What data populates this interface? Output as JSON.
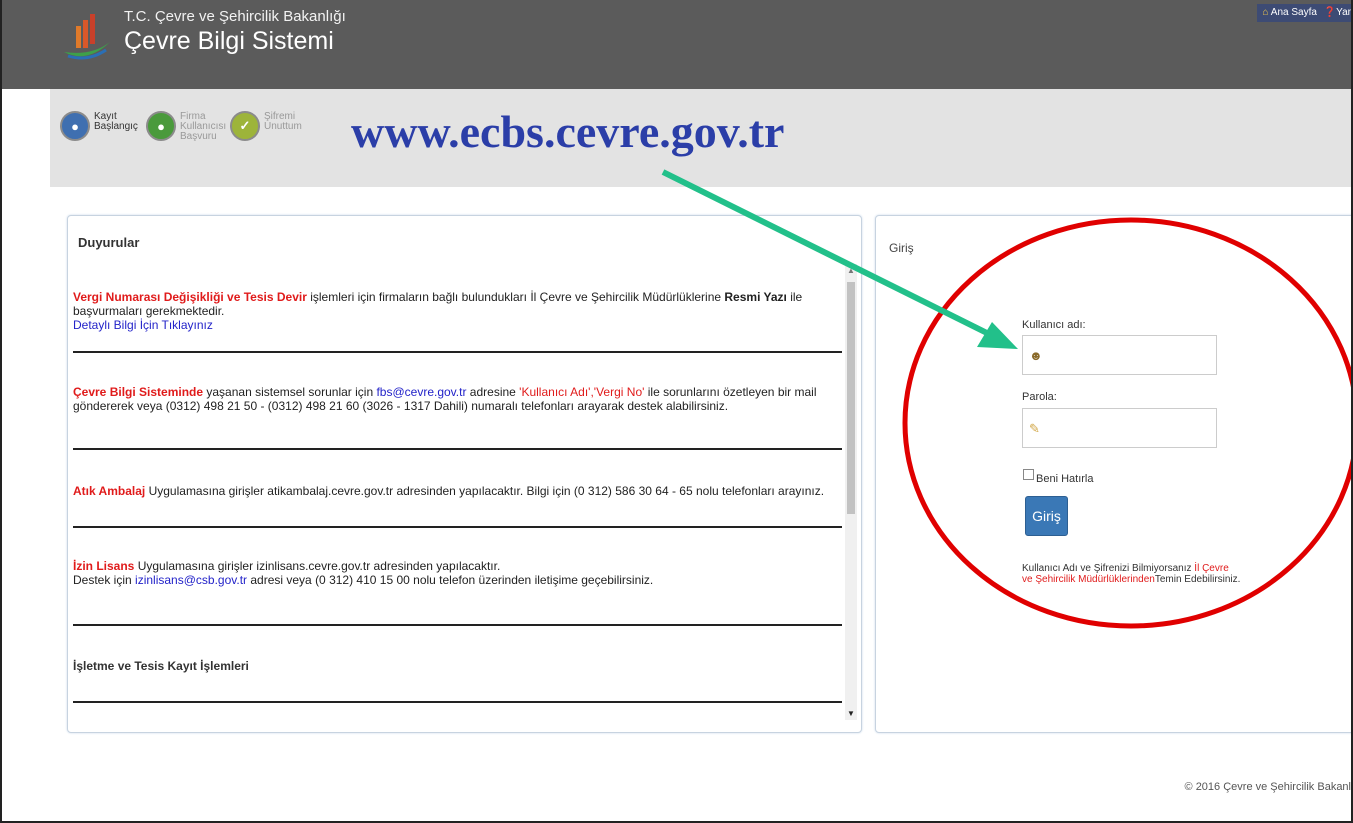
{
  "header": {
    "ministry": "T.C. Çevre ve Şehircilik Bakanlığı",
    "system_name": "Çevre Bilgi Sistemi",
    "home_link": "Ana Sayfa",
    "help_link": "Yar"
  },
  "nav": {
    "items": [
      {
        "label": "Kayıt Başlangıç",
        "icon": "user-icon"
      },
      {
        "label": "Firma Kullanıcısı Başvuru",
        "icon": "company-user-icon"
      },
      {
        "label": "Şifremi Unuttum",
        "icon": "key-icon"
      }
    ]
  },
  "overlay": {
    "url": "www.ecbs.cevre.gov.tr",
    "arrow_color": "#22c08a",
    "circle_color": "#e00000"
  },
  "announcements": {
    "title": "Duyurular",
    "items": [
      {
        "red1": "Vergi Numarası Değişikliği ve Tesis Devir",
        "text1": " işlemleri için firmaların bağlı bulundukları İl Çevre ve Şehircilik Müdürlüklerine ",
        "bold1": "Resmi Yazı",
        "text2": " ile başvurmaları gerekmektedir.",
        "link": "Detaylı Bilgi İçin Tıklayınız"
      },
      {
        "red1": "Çevre Bilgi Sisteminde",
        "text1": " yaşanan sistemsel sorunlar için ",
        "link1": "fbs@cevre.gov.tr",
        "text2": " adresine ",
        "red2": "'Kullanıcı Adı','Vergi No'",
        "text3": " ile sorunlarını özetleyen bir mail göndererek veya (0312) 498 21 50 - (0312) 498 21 60 (3026 - 1317 Dahili) numaralı telefonları arayarak destek alabilirsiniz."
      },
      {
        "red1": "Atık Ambalaj",
        "text1": " Uygulamasına girişler atikambalaj.cevre.gov.tr adresinden yapılacaktır. Bilgi için (0 312) 586 30 64 - 65 nolu telefonları arayınız."
      },
      {
        "red1": "İzin Lisans",
        "text1": " Uygulamasına girişler izinlisans.cevre.gov.tr adresinden yapılacaktır.",
        "text2": "Destek için ",
        "link1": "izinlisans@csb.gov.tr",
        "text3": " adresi veya (0 312) 410 15 00 nolu telefon üzerinden iletişime geçebilirsiniz."
      },
      {
        "heading": "İşletme ve Tesis Kayıt İşlemleri"
      }
    ]
  },
  "login": {
    "title": "Giriş",
    "username_label": "Kullanıcı adı:",
    "password_label": "Parola:",
    "remember_label": "Beni Hatırla",
    "submit_label": "Giriş",
    "help_text": "Kullanıcı Adı ve Şifrenizi Bilmiyorsanız ",
    "help_red": "İl Çevre ve Şehircilik Müdürlüklerinden",
    "help_tail": "Temin Edebilirsiniz."
  },
  "footer": {
    "copyright": "© 2016 Çevre ve Şehircilik Bakanl"
  }
}
